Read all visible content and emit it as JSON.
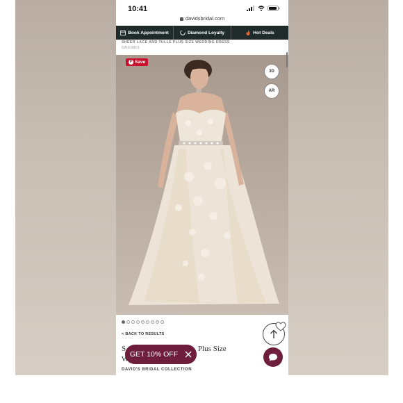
{
  "status_bar": {
    "time": "10:41"
  },
  "browser": {
    "url": "davidsbridal.com"
  },
  "nav": {
    "items": [
      {
        "label": "Book Appointment",
        "icon": "calendar-icon"
      },
      {
        "label": "Diamond Loyalty",
        "icon": "loyalty-icon"
      },
      {
        "label": "Hot Deals",
        "icon": "flame-icon"
      }
    ]
  },
  "product": {
    "title": "SHEER LACE AND TULLE PLUS SIZE WEDDING DRESS",
    "sku": "9WG3861",
    "name_line1_start": "S",
    "name_line1_end": "Plus Size",
    "name_line2": "W",
    "brand": "DAVID'S BRIDAL COLLECTION"
  },
  "gallery": {
    "save_label": "Save",
    "btn_3d": "3D",
    "btn_ar": "AR",
    "dot_count": 9,
    "active_dot": 0
  },
  "back_link": "< BACK TO RESULTS",
  "promo": {
    "label": "GET 10% OFF"
  },
  "colors": {
    "nav_bg": "#1f2a2b",
    "accent": "#6e1d3b",
    "save_red": "#c8102e"
  }
}
